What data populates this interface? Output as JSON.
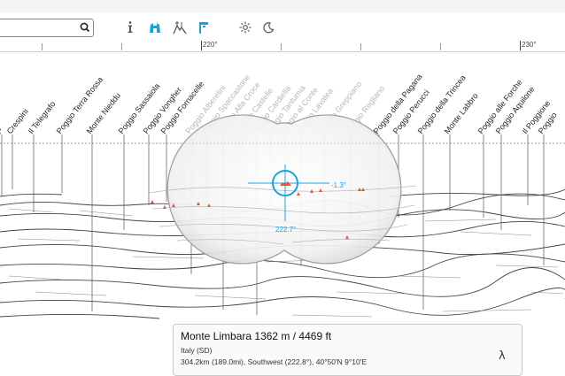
{
  "search": {
    "value": "",
    "placeholder": ""
  },
  "toolbar": {
    "info_icon": "info-icon",
    "binoculars_icon": "binoculars-icon",
    "peaks_icon": "peaks-labels-icon",
    "flag_icon": "flag-icon",
    "sun_icon": "sun-icon",
    "moon_icon": "moon-icon",
    "accent_color": "#1aa3d9"
  },
  "scale": {
    "left_label": "220°",
    "right_label": "230°"
  },
  "peaks": [
    {
      "name": "P"
    },
    {
      "name": "Crespini"
    },
    {
      "name": "Il Telegrafo"
    },
    {
      "name": "Poggio Terra Rossa"
    },
    {
      "name": "Monte Nieddu"
    },
    {
      "name": "Poggio Sassaiola"
    },
    {
      "name": "Poggio Vongher"
    },
    {
      "name": "Poggio Fornacelle"
    },
    {
      "name": "Poggio Alberelini"
    },
    {
      "name": "Poggio Spaccastone"
    },
    {
      "name": "Poggio Alla Croce"
    },
    {
      "name": "Poggio Castelle"
    },
    {
      "name": "Poggio Cardiella"
    },
    {
      "name": "Poggio Tantumia"
    },
    {
      "name": "Poggio al Conte"
    },
    {
      "name": "Poggio Lavatea"
    },
    {
      "name": "Poggio Greppiano"
    },
    {
      "name": "Poggio Rogliano"
    },
    {
      "name": "Poggio della Pagana"
    },
    {
      "name": "Poggio Perucci"
    },
    {
      "name": "Poggio della Trincea"
    },
    {
      "name": "Monte Labbro"
    },
    {
      "name": "Poggio alle Forche"
    },
    {
      "name": "Poggio Aquilone"
    },
    {
      "name": "Il Poggione"
    },
    {
      "name": "Poggio"
    }
  ],
  "reticle": {
    "elevation_angle": "-1.3°",
    "bearing": "222.7°",
    "accent_color": "#1aa3d9",
    "marker_color": "#e8572a"
  },
  "info": {
    "name": "Monte Limbara",
    "height": "1362 m / 4469 ft",
    "country": "Italy (SD)",
    "details": "304.2km (189.0mi), Southwest (222.8°), 40°50'N 9°10'E",
    "pin_icon": "lambda-icon"
  }
}
